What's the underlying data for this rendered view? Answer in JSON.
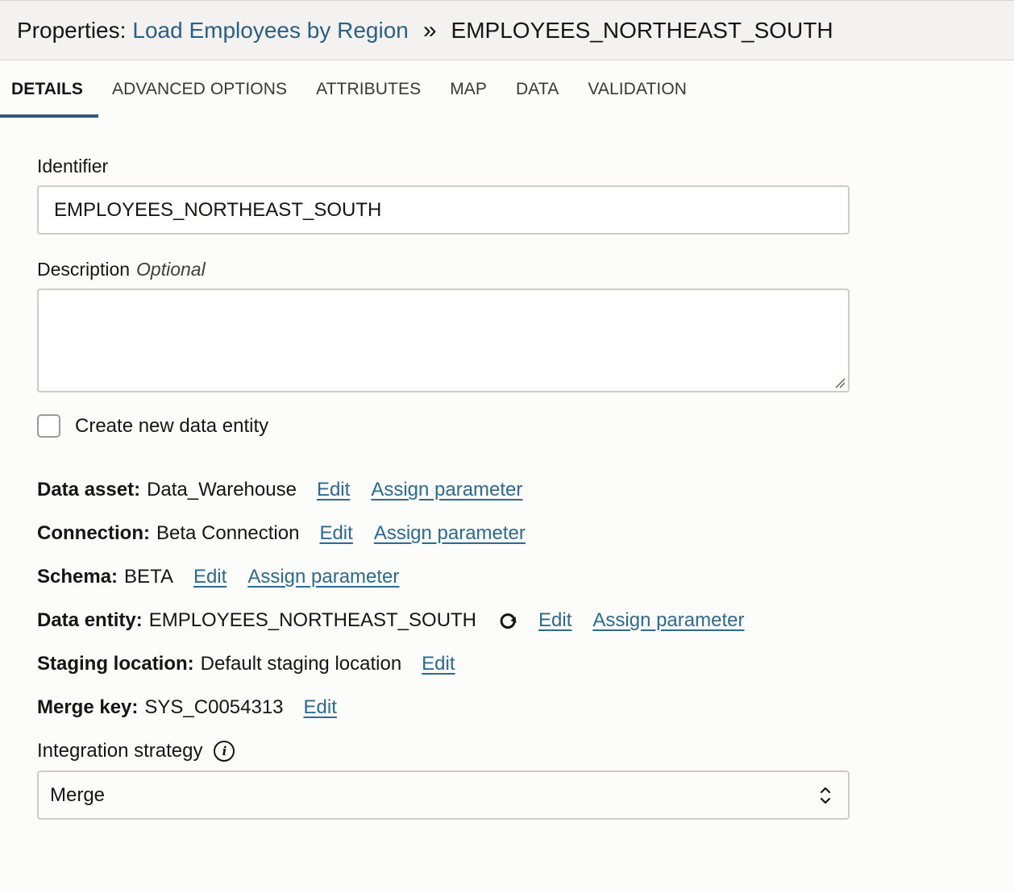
{
  "header": {
    "prefix": "Properties:",
    "parent_link": "Load Employees by Region",
    "separator": "»",
    "current": "EMPLOYEES_NORTHEAST_SOUTH"
  },
  "tabs": [
    {
      "label": "DETAILS",
      "active": true
    },
    {
      "label": "ADVANCED OPTIONS"
    },
    {
      "label": "ATTRIBUTES"
    },
    {
      "label": "MAP"
    },
    {
      "label": "DATA"
    },
    {
      "label": "VALIDATION"
    }
  ],
  "form": {
    "identifier_label": "Identifier",
    "identifier_value": "EMPLOYEES_NORTHEAST_SOUTH",
    "description_label": "Description",
    "description_optional": "Optional",
    "description_value": "",
    "create_entity_label": "Create new data entity",
    "create_entity_checked": false
  },
  "properties": {
    "data_asset": {
      "key": "Data asset:",
      "value": "Data_Warehouse",
      "edit": "Edit",
      "assign": "Assign parameter"
    },
    "connection": {
      "key": "Connection:",
      "value": "Beta Connection",
      "edit": "Edit",
      "assign": "Assign parameter"
    },
    "schema": {
      "key": "Schema:",
      "value": "BETA",
      "edit": "Edit",
      "assign": "Assign parameter"
    },
    "data_entity": {
      "key": "Data entity:",
      "value": "EMPLOYEES_NORTHEAST_SOUTH",
      "edit": "Edit",
      "assign": "Assign parameter"
    },
    "staging_location": {
      "key": "Staging location:",
      "value": "Default staging location",
      "edit": "Edit"
    },
    "merge_key": {
      "key": "Merge key:",
      "value": "SYS_C0054313",
      "edit": "Edit"
    }
  },
  "integration": {
    "label": "Integration strategy",
    "selected": "Merge"
  },
  "icons": {
    "refresh": "refresh-icon",
    "info": "info-icon",
    "select_chevron": "chevron-up-down-icon"
  },
  "colors": {
    "link": "#2c6a91",
    "header_link": "#2c5f84",
    "active_tab_underline": "#2f5a7a"
  }
}
